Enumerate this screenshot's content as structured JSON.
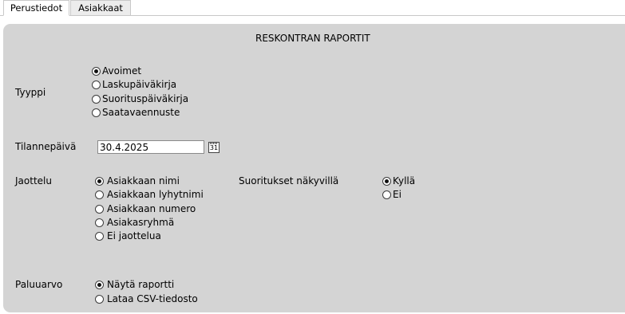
{
  "tabs": [
    {
      "label": "Perustiedot",
      "active": true
    },
    {
      "label": "Asiakkaat",
      "active": false
    }
  ],
  "form": {
    "title": "RESKONTRAN RAPORTIT",
    "tyyppi": {
      "label": "Tyyppi",
      "options": [
        {
          "label": "Avoimet",
          "checked": true
        },
        {
          "label": "Laskupäiväkirja",
          "checked": false
        },
        {
          "label": "Suorituspäiväkirja",
          "checked": false
        },
        {
          "label": "Saatavaennuste",
          "checked": false
        }
      ]
    },
    "tilannepaiva": {
      "label": "Tilannepäivä",
      "value": "30.4.2025",
      "calendar_icon_text": "31"
    },
    "jaottelu": {
      "label": "Jaottelu",
      "options": [
        {
          "label": "Asiakkaan nimi",
          "checked": true
        },
        {
          "label": "Asiakkaan lyhytnimi",
          "checked": false
        },
        {
          "label": "Asiakkaan numero",
          "checked": false
        },
        {
          "label": "Asiakasryhmä",
          "checked": false
        },
        {
          "label": "Ei jaottelua",
          "checked": false
        }
      ]
    },
    "suoritukset": {
      "label": "Suoritukset näkyvillä",
      "options": [
        {
          "label": "Kyllä",
          "checked": true
        },
        {
          "label": "Ei",
          "checked": false
        }
      ]
    },
    "paluuarvo": {
      "label": "Paluuarvo",
      "options": [
        {
          "label": "Näytä raportti",
          "checked": true
        },
        {
          "label": "Lataa CSV-tiedosto",
          "checked": false
        }
      ]
    }
  },
  "colors": {
    "panel_bg": "#d4d4d4",
    "tab_border": "#c8c8c8"
  }
}
